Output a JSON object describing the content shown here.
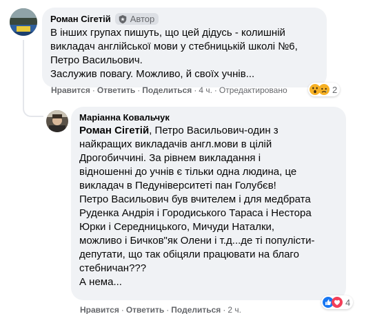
{
  "comment1": {
    "author": "Роман Сігетій",
    "badge_label": "Автор",
    "badge_icon": "shield-star-icon",
    "text": "В інших групах пишуть, що цей дідусь - колишній\nвикладач англійської мови у стебницькій школі №6,\nПетро Васильович.\nЗаслужив повагу. Можливо, й своїх учнів...",
    "actions": {
      "like": "Нравится",
      "reply": "Ответить",
      "share": "Поделиться",
      "time": "4 ч.",
      "edited": "Отредактировано"
    },
    "reactions": {
      "icons": [
        "wow-icon",
        "sad-icon"
      ],
      "count": "2"
    }
  },
  "comment2": {
    "author": "Маріанна Ковальчук",
    "mention": "Роман Сігетій",
    "text_after_mention": ", Петро Васильович-один з\nнайкращих викладачів англ.мови в цілій\nДрогобиччині. За рівнем викладання і\nвідношенні до учнів є тільки одна людина, це\nвикладач в Педуніверситеті пан Голубєв!\nПетро Васильович був вчителем і для медбрата\nРуденка Андрія і Городиського Тараса і Нестора\nЮрки і Середницького, Мичуди Наталки,\nможливо і Бичков\"як Олени і т.д...де ті популісти-\nдепутати, що так обіцяли працювати на благо\nстебничан???\nА нема...",
    "actions": {
      "like": "Нравится",
      "reply": "Ответить",
      "share": "Поделиться",
      "time": "2 ч."
    },
    "reactions": {
      "icons": [
        "like-icon",
        "love-icon"
      ],
      "count": "4"
    }
  },
  "colors": {
    "bubble": "#f0f2f5",
    "meta": "#65676b",
    "like_blue": "#1877f2",
    "love_red": "#f33e58",
    "wow_yellow": "#f7b125"
  }
}
